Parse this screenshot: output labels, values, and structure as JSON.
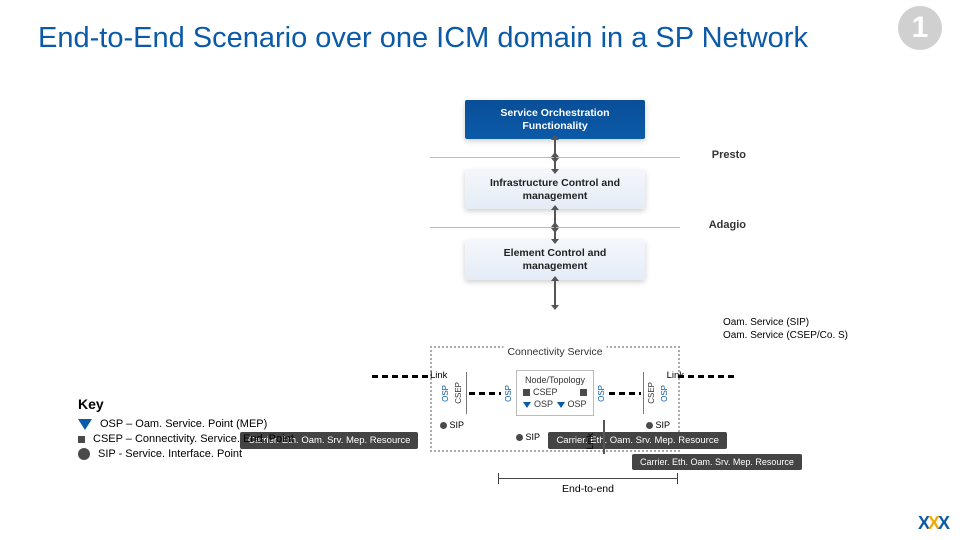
{
  "title": "End-to-End Scenario over one ICM domain in a SP Network",
  "corner_badge": "1",
  "stack": {
    "box1": "Service Orchestration Functionality",
    "label1": "Presto",
    "box2": "Infrastructure Control and management",
    "label2": "Adagio",
    "box3": "Element Control and management"
  },
  "oam": {
    "line1": "Oam. Service (SIP)",
    "line2": "Oam. Service (CSEP/Co. S)"
  },
  "svc": {
    "title": "Connectivity Service",
    "link": "Link",
    "node_title": "Node/Topology",
    "sip": "SIP",
    "osp": "OSP",
    "csep": "CSEP"
  },
  "carriers": {
    "a": "Carrier. Eth. Oam. Srv. Mep. Resource",
    "b": "Carrier. Eth. Oam. Srv. Mep. Resource",
    "c": "Carrier. Eth. Oam. Srv. Mep. Resource",
    "link": "Link"
  },
  "e2e": "End-to-end",
  "key": {
    "title": "Key",
    "osp": "OSP – Oam. Service. Point (MEP)",
    "csep": "CSEP – Connectivity. Service. End. Point",
    "sip": "SIP - Service. Interface. Point"
  }
}
